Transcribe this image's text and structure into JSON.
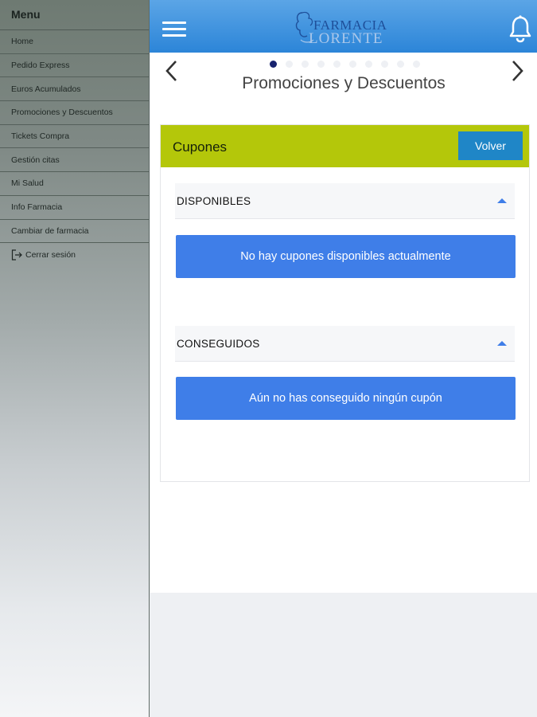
{
  "sidebar": {
    "title": "Menu",
    "items": [
      {
        "label": "Home"
      },
      {
        "label": "Pedido Express"
      },
      {
        "label": "Euros Acumulados"
      },
      {
        "label": "Promociones y Descuentos"
      },
      {
        "label": "Tickets Compra"
      },
      {
        "label": "Gestión citas"
      },
      {
        "label": "Mi Salud"
      },
      {
        "label": "Info Farmacia"
      },
      {
        "label": "Cambiar de farmacia"
      }
    ],
    "logout_label": "Cerrar sesión"
  },
  "header": {
    "logo_line1": "FARMACIA",
    "logo_line2": "LORENTE",
    "icons": [
      "hamburger-menu-icon",
      "bell-icon"
    ]
  },
  "main": {
    "page_title": "Promociones y Descuentos",
    "carousel": {
      "total_dots": 10,
      "active_index": 0
    },
    "card": {
      "title": "Cupones",
      "back_button": "Volver",
      "sections": [
        {
          "title": "DISPONIBLES",
          "message": "No hay cupones disponibles actualmente"
        },
        {
          "title": "CONSEGUIDOS",
          "message": "Aún no has conseguido ningún cupón"
        }
      ]
    }
  },
  "colors": {
    "header_blue": "#2c85d8",
    "card_header_green": "#b4c70a",
    "button_blue": "#1f86c7",
    "notice_blue": "#3f7ee8",
    "active_dot": "#18226e"
  }
}
